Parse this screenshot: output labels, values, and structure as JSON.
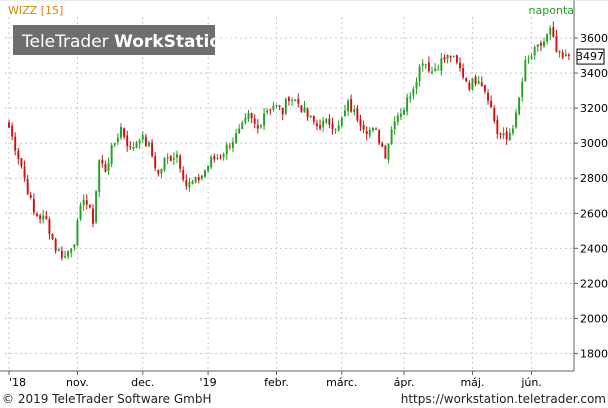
{
  "chart_data": {
    "type": "candlestick",
    "symbol_label": "WIZZ [15]",
    "interval_label": "naponta",
    "watermark": {
      "brand": "TeleTrader",
      "product": "WorkStation"
    },
    "last_price_label": "3497",
    "ylim": [
      1700,
      3720
    ],
    "y_ticks": [
      1800,
      2000,
      2200,
      2400,
      2600,
      2800,
      3000,
      3200,
      3400,
      3600
    ],
    "x_ticks": [
      "'18",
      "nov.",
      "dec.",
      "'19",
      "febr.",
      "márc.",
      "ápr.",
      "máj.",
      "jún."
    ],
    "x_tick_bar_index": [
      0,
      22,
      43,
      64,
      86,
      107,
      127,
      149,
      168
    ],
    "num_bars": 181,
    "price_anchors": [
      [
        0,
        3090
      ],
      [
        4,
        2870
      ],
      [
        8,
        2600
      ],
      [
        12,
        2560
      ],
      [
        15,
        2400
      ],
      [
        18,
        2350
      ],
      [
        21,
        2450
      ],
      [
        24,
        2700
      ],
      [
        27,
        2560
      ],
      [
        29,
        2900
      ],
      [
        31,
        2850
      ],
      [
        33,
        2960
      ],
      [
        36,
        3090
      ],
      [
        39,
        2960
      ],
      [
        42,
        3040
      ],
      [
        45,
        2980
      ],
      [
        48,
        2820
      ],
      [
        50,
        2900
      ],
      [
        54,
        2940
      ],
      [
        57,
        2760
      ],
      [
        60,
        2780
      ],
      [
        62,
        2820
      ],
      [
        65,
        2900
      ],
      [
        68,
        2930
      ],
      [
        71,
        3000
      ],
      [
        74,
        3060
      ],
      [
        77,
        3150
      ],
      [
        80,
        3080
      ],
      [
        82,
        3180
      ],
      [
        85,
        3220
      ],
      [
        88,
        3180
      ],
      [
        90,
        3270
      ],
      [
        93,
        3230
      ],
      [
        96,
        3150
      ],
      [
        99,
        3100
      ],
      [
        103,
        3120
      ],
      [
        106,
        3090
      ],
      [
        109,
        3220
      ],
      [
        112,
        3150
      ],
      [
        115,
        3080
      ],
      [
        118,
        3060
      ],
      [
        121,
        2940
      ],
      [
        124,
        3150
      ],
      [
        127,
        3200
      ],
      [
        130,
        3330
      ],
      [
        133,
        3480
      ],
      [
        136,
        3410
      ],
      [
        139,
        3470
      ],
      [
        142,
        3500
      ],
      [
        145,
        3420
      ],
      [
        148,
        3330
      ],
      [
        151,
        3380
      ],
      [
        154,
        3270
      ],
      [
        157,
        3060
      ],
      [
        160,
        3020
      ],
      [
        163,
        3150
      ],
      [
        166,
        3450
      ],
      [
        169,
        3520
      ],
      [
        172,
        3580
      ],
      [
        174,
        3640
      ],
      [
        176,
        3520
      ],
      [
        178,
        3480
      ],
      [
        180,
        3497
      ]
    ],
    "colors": {
      "up": "#22a022",
      "down": "#d01010",
      "grid": "#c8c8c8",
      "axis": "#606060",
      "symbol": "#e08000",
      "interval": "#22a022"
    }
  },
  "footer": {
    "copyright": "© 2019 TeleTrader Software GmbH",
    "url": "https://workstation.teletrader.com"
  }
}
